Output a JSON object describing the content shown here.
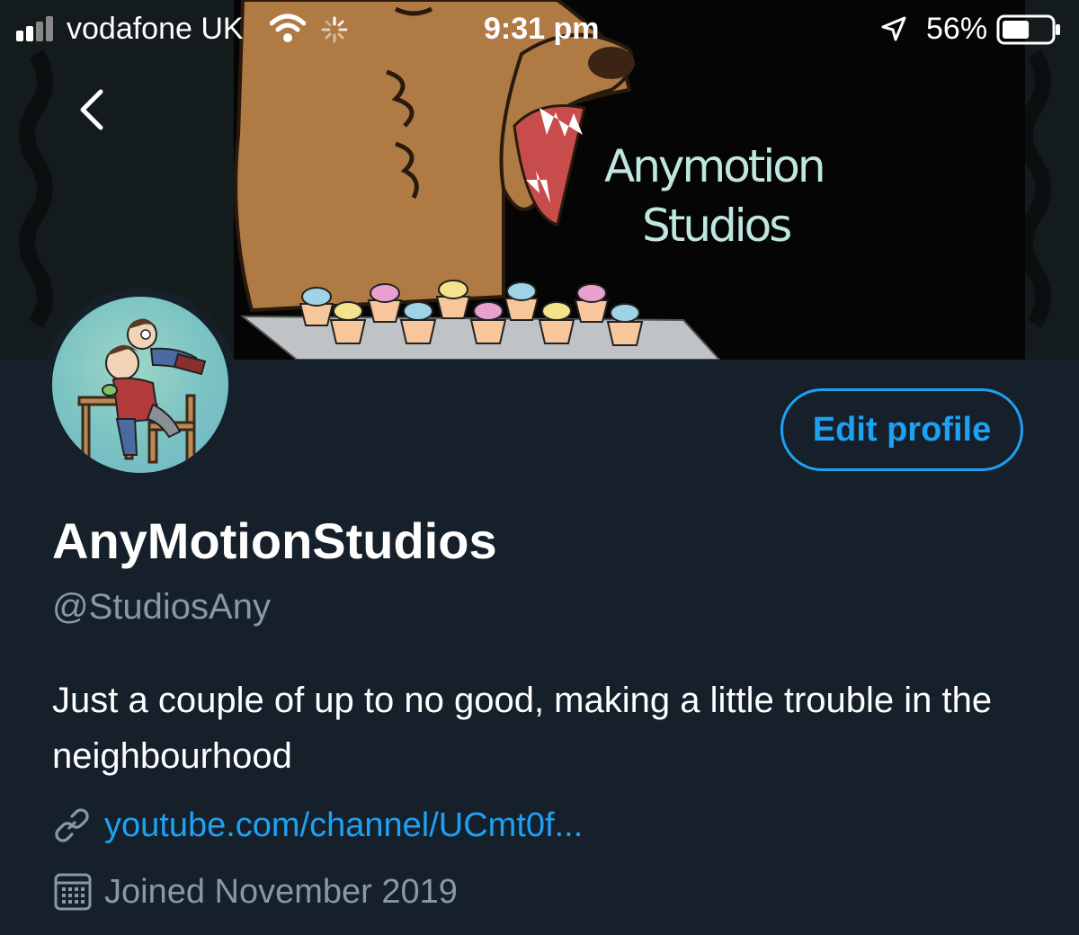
{
  "status_bar": {
    "carrier": "vodafone UK",
    "time": "9:31 pm",
    "battery_percent": "56%",
    "battery_level": 0.56,
    "icons": [
      "signal-icon",
      "wifi-icon",
      "activity-spinner-icon",
      "location-arrow-icon",
      "battery-icon"
    ]
  },
  "banner": {
    "title_line_1": "Anymotion",
    "title_line_2": "Studios",
    "illustration": "roaring brown bear with a tray of pastel cupcakes on dark background"
  },
  "navigation": {
    "back_icon": "chevron-left-icon"
  },
  "profile": {
    "avatar_illustration": "two cartoon characters at a wooden chair on teal background",
    "edit_button_label": "Edit profile",
    "display_name": "AnyMotionStudios",
    "handle": "@StudiosAny",
    "bio": "Just a couple of up to no good, making a little trouble in the neighbourhood",
    "website": "youtube.com/channel/UCmt0f...",
    "joined": "Joined November 2019"
  },
  "colors": {
    "background": "#15202b",
    "accent": "#1da1f2",
    "secondary_text": "#8899a6",
    "primary_text": "#ffffff"
  }
}
